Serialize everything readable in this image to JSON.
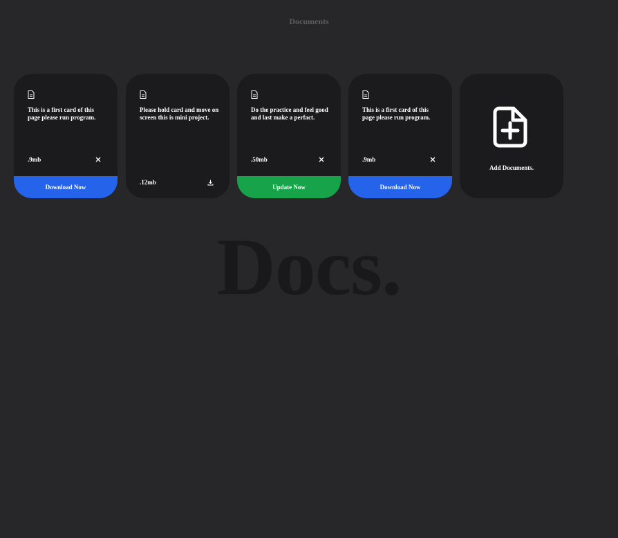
{
  "header": {
    "title": "Documents"
  },
  "background_word": "Docs.",
  "cards": [
    {
      "text": "This is a first card of this page please run program.",
      "size": ".9mb",
      "action_icon": "close-icon",
      "footer": {
        "label": "Download Now",
        "color": "#2563eb"
      }
    },
    {
      "text": "Please hold card and move on screen this is mini project.",
      "size": ".12mb",
      "action_icon": "download-icon",
      "footer": null
    },
    {
      "text": "Do the practice and feel good and last make a perfact.",
      "size": ".50mb",
      "action_icon": "close-icon",
      "footer": {
        "label": "Update Now",
        "color": "#16a34a"
      }
    },
    {
      "text": "This is a first card of this page please run program.",
      "size": ".9mb",
      "action_icon": "close-icon",
      "footer": {
        "label": "Download Now",
        "color": "#2563eb"
      }
    }
  ],
  "add_card": {
    "label": "Add Documents.",
    "icon": "file-plus-icon"
  },
  "colors": {
    "background": "#27272a",
    "card": "#1b1b1d",
    "blue": "#2563eb",
    "green": "#16a34a"
  }
}
